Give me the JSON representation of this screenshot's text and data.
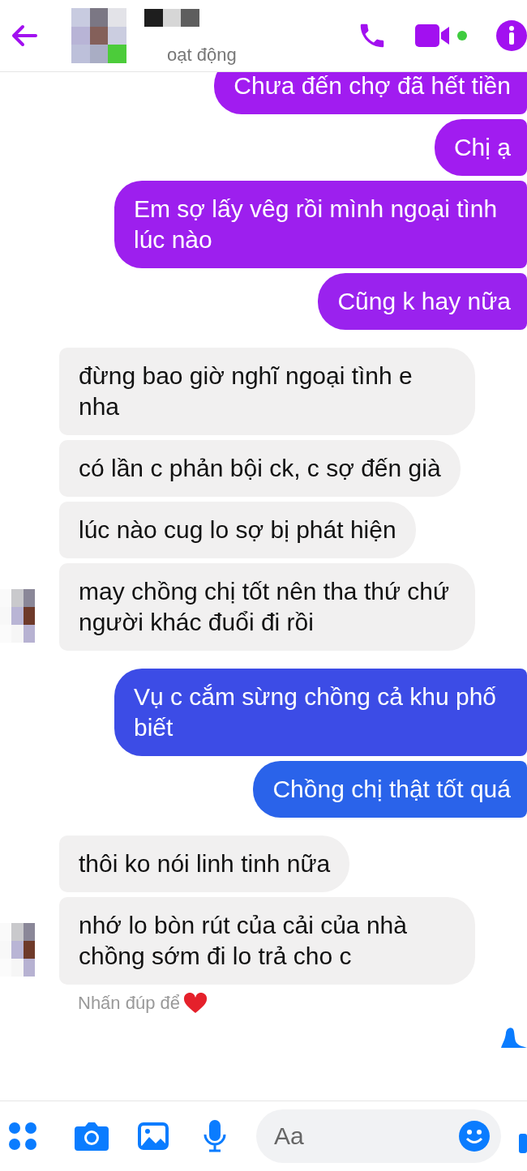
{
  "header": {
    "status": "oạt động"
  },
  "messages": [
    {
      "kind": "out",
      "text": "Chưa đến chợ đã hết tiền",
      "color": "#a11cf0"
    },
    {
      "kind": "out",
      "text": "Chị ạ",
      "color": "#a11cf0"
    },
    {
      "kind": "out",
      "text": "Em sợ lấy vêg rồi mình ngoại tình lúc nào",
      "color": "#9d1fee"
    },
    {
      "kind": "out",
      "text": "Cũng k hay nữa",
      "color": "#9a22ee"
    },
    {
      "kind": "in",
      "text": "đừng bao giờ nghĩ ngoại tình e nha",
      "avatar": false
    },
    {
      "kind": "in",
      "text": "có lần c phản bội ck, c sợ đến già",
      "avatar": false
    },
    {
      "kind": "in",
      "text": "lúc nào cug lo sợ bị phát hiện",
      "avatar": false
    },
    {
      "kind": "in",
      "text": "may chồng chị tốt nên tha thứ chứ người khác đuổi đi rồi",
      "avatar": true
    },
    {
      "kind": "out",
      "text": "Vụ c cắm sừng chồng cả khu phố biết",
      "color": "#3c4ce6"
    },
    {
      "kind": "out",
      "text": "Chồng chị thật tốt quá",
      "color": "#2a63ea"
    },
    {
      "kind": "in",
      "text": "thôi ko nói linh tinh nữa",
      "avatar": false
    },
    {
      "kind": "in",
      "text": "nhớ lo bòn rút của cải của nhà chồng sớm đi lo trả cho c",
      "avatar": true
    }
  ],
  "hint": "Nhấn đúp để",
  "composer": {
    "placeholder": "Aa"
  }
}
